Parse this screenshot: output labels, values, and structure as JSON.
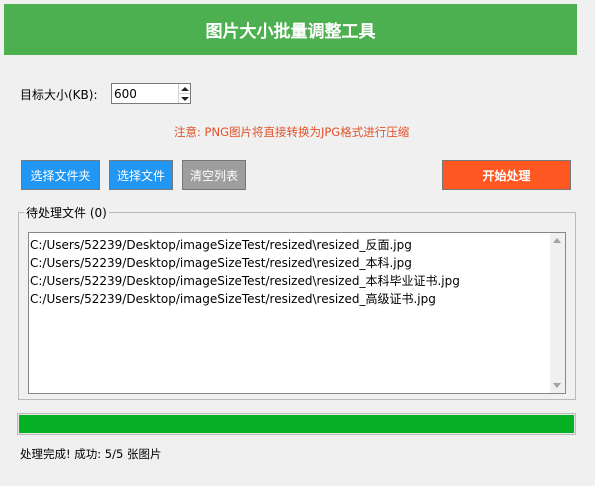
{
  "window": {
    "title": "图片大小批量调整工具",
    "accent_color": "#4caf50"
  },
  "settings": {
    "target_size_label": "目标大小(KB):",
    "target_size_value": "600",
    "note": "注意: PNG图片将直接转换为JPG格式进行压缩",
    "note_color": "#e0522a"
  },
  "toolbar": {
    "select_folder_label": "选择文件夹",
    "select_files_label": "选择文件",
    "clear_list_label": "清空列表",
    "start_label": "开始处理",
    "select_color": "#2196f3",
    "clear_color": "#9e9e9e",
    "start_color": "#ff5722"
  },
  "file_list": {
    "title": "待处理文件 (0)",
    "items": [
      "C:/Users/52239/Desktop/imageSizeTest/resized\\resized_反面.jpg",
      "C:/Users/52239/Desktop/imageSizeTest/resized\\resized_本科.jpg",
      "C:/Users/52239/Desktop/imageSizeTest/resized\\resized_本科毕业证书.jpg",
      "C:/Users/52239/Desktop/imageSizeTest/resized\\resized_高级证书.jpg"
    ]
  },
  "progress": {
    "percent": 100,
    "fill_color": "#06b025"
  },
  "status": {
    "text": "处理完成! 成功: 5/5 张图片"
  }
}
